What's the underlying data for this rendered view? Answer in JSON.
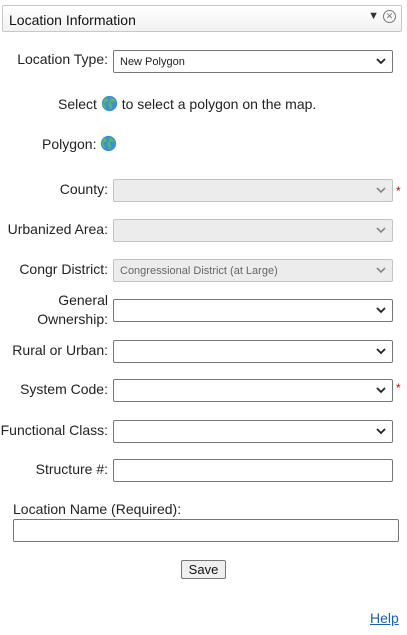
{
  "panel": {
    "title": "Location Information",
    "collapse_icon": "caret-down-icon",
    "close_icon": "circle-close-icon"
  },
  "location_type": {
    "label": "Location Type:",
    "value": "New Polygon"
  },
  "instruction": {
    "before": "Select",
    "icon": "globe-icon",
    "after": "to select a polygon on the map."
  },
  "polygon": {
    "label": "Polygon:",
    "icon": "globe-icon"
  },
  "fields": {
    "county": {
      "label": "County:",
      "value": "",
      "required": "*"
    },
    "urbanized_area": {
      "label": "Urbanized Area:",
      "value": ""
    },
    "congr_district": {
      "label": "Congr District:",
      "value": "Congressional District (at Large)"
    },
    "general_ownership": {
      "label_line1": "General",
      "label_line2": "Ownership:",
      "value": ""
    },
    "rural_or_urban": {
      "label": "Rural or Urban:",
      "value": ""
    },
    "system_code": {
      "label": "System Code:",
      "value": "",
      "required": "*"
    },
    "functional_class": {
      "label": "Functional Class:",
      "value": ""
    },
    "structure_number": {
      "label": "Structure #:",
      "value": ""
    }
  },
  "location_name": {
    "label": "Location Name (Required):",
    "value": ""
  },
  "save_label": "Save",
  "help_label": "Help",
  "colors": {
    "required": "#d40000",
    "link": "#1a5fb4",
    "disabled_bg": "#ececec"
  }
}
